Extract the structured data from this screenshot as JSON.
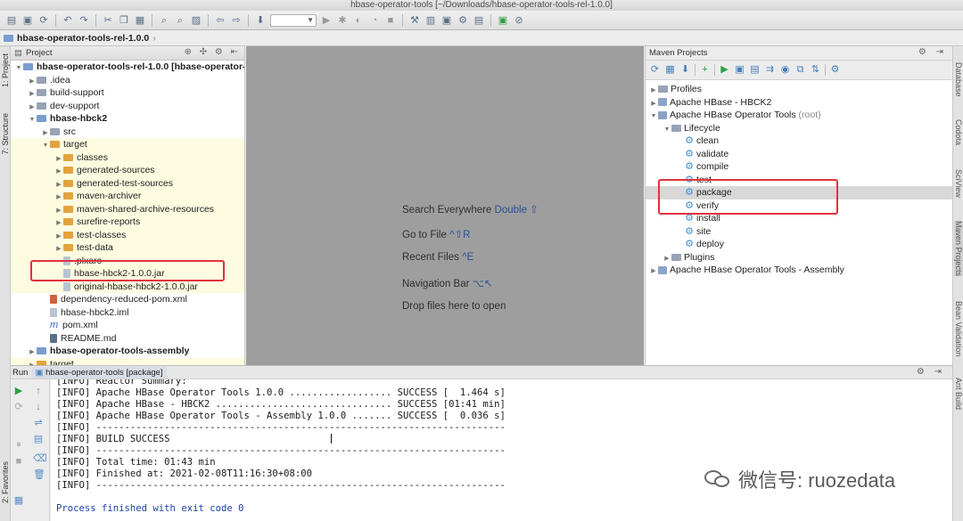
{
  "window": {
    "title": "hbase-operator-tools [~/Downloads/hbase-operator-tools-rel-1.0.0]"
  },
  "breadcrumb": {
    "label": "hbase-operator-tools-rel-1.0.0"
  },
  "left_stripe": {
    "project": "1: Project",
    "structure": "7: Structure",
    "favorites": "2: Favorites"
  },
  "project_panel": {
    "header": "Project",
    "tree": [
      {
        "label": "hbase-operator-tools-rel-1.0.0 [hbase-operator-",
        "indent": 0,
        "arrow": "▼",
        "icon": "folder-module",
        "bold": true,
        "yellow": false
      },
      {
        "label": ".idea",
        "indent": 1,
        "arrow": "▶",
        "icon": "folder-gray",
        "bold": false,
        "yellow": false
      },
      {
        "label": "build-support",
        "indent": 1,
        "arrow": "▶",
        "icon": "folder-gray",
        "bold": false,
        "yellow": false
      },
      {
        "label": "dev-support",
        "indent": 1,
        "arrow": "▶",
        "icon": "folder-gray",
        "bold": false,
        "yellow": false
      },
      {
        "label": "hbase-hbck2",
        "indent": 1,
        "arrow": "▼",
        "icon": "folder-module",
        "bold": true,
        "yellow": false
      },
      {
        "label": "src",
        "indent": 2,
        "arrow": "▶",
        "icon": "folder-gray",
        "bold": false,
        "yellow": false
      },
      {
        "label": "target",
        "indent": 2,
        "arrow": "▼",
        "icon": "folder-orange",
        "bold": false,
        "yellow": true
      },
      {
        "label": "classes",
        "indent": 3,
        "arrow": "▶",
        "icon": "folder-orange",
        "bold": false,
        "yellow": true
      },
      {
        "label": "generated-sources",
        "indent": 3,
        "arrow": "▶",
        "icon": "folder-orange",
        "bold": false,
        "yellow": true
      },
      {
        "label": "generated-test-sources",
        "indent": 3,
        "arrow": "▶",
        "icon": "folder-orange",
        "bold": false,
        "yellow": true
      },
      {
        "label": "maven-archiver",
        "indent": 3,
        "arrow": "▶",
        "icon": "folder-orange",
        "bold": false,
        "yellow": true
      },
      {
        "label": "maven-shared-archive-resources",
        "indent": 3,
        "arrow": "▶",
        "icon": "folder-orange",
        "bold": false,
        "yellow": true
      },
      {
        "label": "surefire-reports",
        "indent": 3,
        "arrow": "▶",
        "icon": "folder-orange",
        "bold": false,
        "yellow": true
      },
      {
        "label": "test-classes",
        "indent": 3,
        "arrow": "▶",
        "icon": "folder-orange",
        "bold": false,
        "yellow": true
      },
      {
        "label": "test-data",
        "indent": 3,
        "arrow": "▶",
        "icon": "folder-orange",
        "bold": false,
        "yellow": true
      },
      {
        "label": ".plxarc",
        "indent": 3,
        "arrow": "",
        "icon": "file",
        "bold": false,
        "yellow": true
      },
      {
        "label": "hbase-hbck2-1.0.0.jar",
        "indent": 3,
        "arrow": "",
        "icon": "file",
        "bold": false,
        "yellow": true
      },
      {
        "label": "original-hbase-hbck2-1.0.0.jar",
        "indent": 3,
        "arrow": "",
        "icon": "file",
        "bold": false,
        "yellow": true
      },
      {
        "label": "dependency-reduced-pom.xml",
        "indent": 2,
        "arrow": "",
        "icon": "file-xml",
        "bold": false,
        "yellow": false
      },
      {
        "label": "hbase-hbck2.iml",
        "indent": 2,
        "arrow": "",
        "icon": "file",
        "bold": false,
        "yellow": false
      },
      {
        "label": "pom.xml",
        "indent": 2,
        "arrow": "",
        "icon": "file-m",
        "bold": false,
        "yellow": false
      },
      {
        "label": "README.md",
        "indent": 2,
        "arrow": "",
        "icon": "file-md",
        "bold": false,
        "yellow": false
      },
      {
        "label": "hbase-operator-tools-assembly",
        "indent": 1,
        "arrow": "▶",
        "icon": "folder-module",
        "bold": true,
        "yellow": false
      },
      {
        "label": "target",
        "indent": 1,
        "arrow": "▶",
        "icon": "folder-orange",
        "bold": false,
        "yellow": true
      }
    ]
  },
  "editor_hints": [
    {
      "text": "Search Everywhere ",
      "key": "Double ⇧"
    },
    {
      "text": "Go to File ",
      "key": "^⇧R"
    },
    {
      "text": "Recent Files ",
      "key": "^E"
    },
    {
      "text": "Navigation Bar ",
      "key": "⌥↖"
    },
    {
      "text": "Drop files here to open",
      "key": ""
    }
  ],
  "maven_panel": {
    "header": "Maven Projects",
    "tree": [
      {
        "label": "Profiles",
        "suffix": "",
        "indent": 0,
        "arrow": "▶",
        "icon": "folder"
      },
      {
        "label": "Apache HBase - HBCK2",
        "suffix": "",
        "indent": 0,
        "arrow": "▶",
        "icon": "maven"
      },
      {
        "label": "Apache HBase Operator Tools",
        "suffix": " (root)",
        "indent": 0,
        "arrow": "▼",
        "icon": "maven"
      },
      {
        "label": "Lifecycle",
        "suffix": "",
        "indent": 1,
        "arrow": "▼",
        "icon": "folder"
      },
      {
        "label": "clean",
        "suffix": "",
        "indent": 2,
        "arrow": "",
        "icon": "gear"
      },
      {
        "label": "validate",
        "suffix": "",
        "indent": 2,
        "arrow": "",
        "icon": "gear"
      },
      {
        "label": "compile",
        "suffix": "",
        "indent": 2,
        "arrow": "",
        "icon": "gear"
      },
      {
        "label": "test",
        "suffix": "",
        "indent": 2,
        "arrow": "",
        "icon": "gear"
      },
      {
        "label": "package",
        "suffix": "",
        "indent": 2,
        "arrow": "",
        "icon": "gear",
        "selected": true
      },
      {
        "label": "verify",
        "suffix": "",
        "indent": 2,
        "arrow": "",
        "icon": "gear"
      },
      {
        "label": "install",
        "suffix": "",
        "indent": 2,
        "arrow": "",
        "icon": "gear"
      },
      {
        "label": "site",
        "suffix": "",
        "indent": 2,
        "arrow": "",
        "icon": "gear"
      },
      {
        "label": "deploy",
        "suffix": "",
        "indent": 2,
        "arrow": "",
        "icon": "gear"
      },
      {
        "label": "Plugins",
        "suffix": "",
        "indent": 1,
        "arrow": "▶",
        "icon": "folder"
      },
      {
        "label": "Apache HBase Operator Tools - Assembly",
        "suffix": "",
        "indent": 0,
        "arrow": "▶",
        "icon": "maven"
      }
    ]
  },
  "right_stripe": {
    "database": "Database",
    "codota": "Codota",
    "sciview": "SciView",
    "maven": "Maven Projects",
    "bean": "Bean Validation",
    "ant": "Ant Build"
  },
  "run_panel": {
    "label": "Run",
    "tab": "hbase-operator-tools [package]",
    "console": [
      "[INFO] Reactor Summary:",
      "[INFO] Apache HBase Operator Tools 1.0.0 .................. SUCCESS [  1.464 s]",
      "[INFO] Apache HBase - HBCK2 ............................... SUCCESS [01:41 min]",
      "[INFO] Apache HBase Operator Tools - Assembly 1.0.0 ....... SUCCESS [  0.036 s]",
      "[INFO] ------------------------------------------------------------------------",
      "[INFO] BUILD SUCCESS",
      "[INFO] ------------------------------------------------------------------------",
      "[INFO] Total time: 01:43 min",
      "[INFO] Finished at: 2021-02-08T11:16:30+08:00",
      "[INFO] ------------------------------------------------------------------------",
      "",
      "Process finished with exit code 0"
    ]
  },
  "watermark": {
    "text": "微信号: ruozedata"
  },
  "colors": {
    "highlight_box": "#e0323e",
    "target_folder_bg": "#fdfbe0",
    "editor_bg": "#9e9e9e"
  }
}
